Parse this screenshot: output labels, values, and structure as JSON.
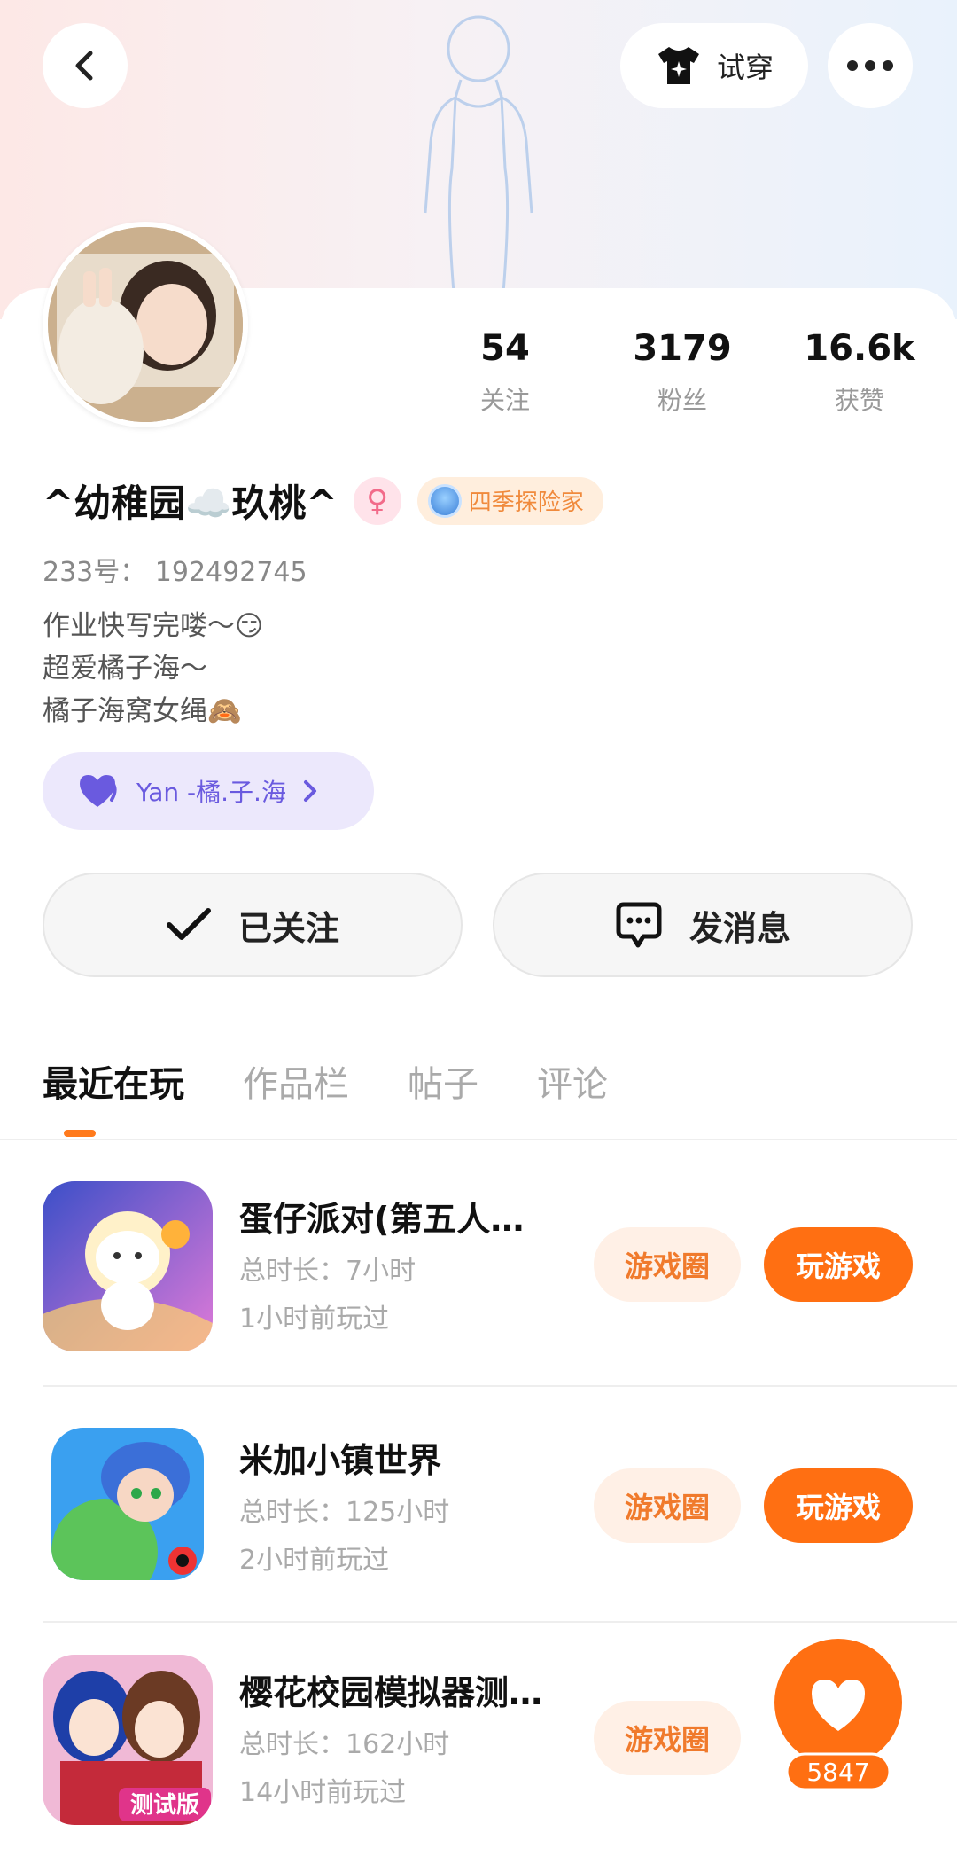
{
  "header": {
    "try_on_label": "试穿"
  },
  "profile": {
    "name": "^幼稚园☁️玖桃^",
    "gender_symbol": "♀",
    "badge_label": "四季探险家",
    "uid": "233号：  192492745",
    "bio": [
      "作业快写完喽～😏",
      "超爱橘子海～",
      "橘子海窝女绳🙈"
    ],
    "fan_chip_label": "Yan -橘.子.海"
  },
  "stats": [
    {
      "value": "54",
      "label": "关注"
    },
    {
      "value": "3179",
      "label": "粉丝"
    },
    {
      "value": "16.6k",
      "label": "获赞"
    }
  ],
  "actions": {
    "follow_label": "已关注",
    "message_label": "发消息"
  },
  "tabs": [
    "最近在玩",
    "作品栏",
    "帖子",
    "评论"
  ],
  "games": [
    {
      "title": "蛋仔派对(第五人…",
      "duration": "总时长：7小时",
      "last_played": "1小时前玩过",
      "circle_label": "游戏圈",
      "play_label": "玩游戏"
    },
    {
      "title": "米加小镇世界",
      "duration": "总时长：125小时",
      "last_played": "2小时前玩过",
      "circle_label": "游戏圈",
      "play_label": "玩游戏"
    },
    {
      "title": "樱花校园模拟器测…",
      "duration": "总时长：162小时",
      "last_played": "14小时前玩过",
      "circle_label": "游戏圈",
      "play_label": ""
    }
  ],
  "game_icon_text": {
    "game3_badge": "测试版"
  },
  "like_fab": {
    "count": "5847"
  },
  "colors": {
    "accent": "#ff6f12",
    "accent_light": "#fff0e6",
    "fan_chip_bg": "#ece8fc",
    "fan_chip_text": "#6a5adf"
  }
}
